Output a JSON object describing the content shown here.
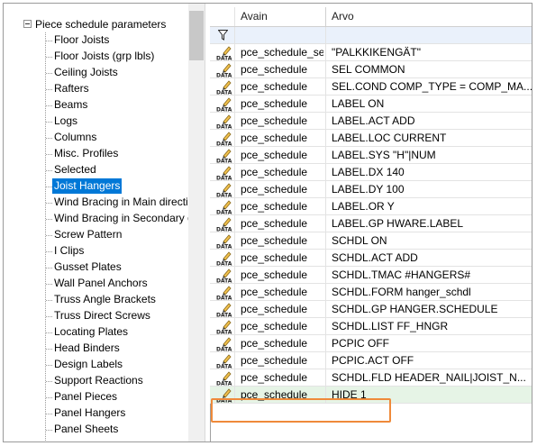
{
  "tree": {
    "root_label": "Piece schedule parameters",
    "items": [
      {
        "label": "Floor Joists"
      },
      {
        "label": "Floor Joists (grp lbls)"
      },
      {
        "label": "Ceiling Joists"
      },
      {
        "label": "Rafters"
      },
      {
        "label": "Beams"
      },
      {
        "label": "Logs"
      },
      {
        "label": "Columns"
      },
      {
        "label": "Misc. Profiles"
      },
      {
        "label": "Selected"
      },
      {
        "label": "Joist Hangers",
        "selected": true
      },
      {
        "label": "Wind Bracing in Main directi"
      },
      {
        "label": "Wind Bracing in Secondary d"
      },
      {
        "label": "Screw Pattern"
      },
      {
        "label": "I Clips"
      },
      {
        "label": "Gusset Plates"
      },
      {
        "label": "Wall Panel Anchors"
      },
      {
        "label": "Truss Angle Brackets"
      },
      {
        "label": "Truss Direct Screws"
      },
      {
        "label": "Locating Plates"
      },
      {
        "label": "Head Binders"
      },
      {
        "label": "Design Labels"
      },
      {
        "label": "Support Reactions"
      },
      {
        "label": "Panel Pieces"
      },
      {
        "label": "Panel Hangers"
      },
      {
        "label": "Panel Sheets"
      }
    ]
  },
  "grid": {
    "columns": [
      "Avain",
      "Arvo"
    ],
    "filter_icon": "funnel-icon",
    "row_icon": "data-pencil-icon",
    "rows": [
      {
        "key": "pce_schedule_set",
        "value": "\"PALKKIKENGÄT\""
      },
      {
        "key": "pce_schedule",
        "value": "SEL COMMON"
      },
      {
        "key": "pce_schedule",
        "value": "SEL.COND COMP_TYPE = COMP_MA..."
      },
      {
        "key": "pce_schedule",
        "value": "LABEL ON"
      },
      {
        "key": "pce_schedule",
        "value": "LABEL.ACT ADD"
      },
      {
        "key": "pce_schedule",
        "value": "LABEL.LOC CURRENT"
      },
      {
        "key": "pce_schedule",
        "value": "LABEL.SYS \"H\"|NUM"
      },
      {
        "key": "pce_schedule",
        "value": "LABEL.DX 140"
      },
      {
        "key": "pce_schedule",
        "value": "LABEL.DY 100"
      },
      {
        "key": "pce_schedule",
        "value": "LABEL.OR Y"
      },
      {
        "key": "pce_schedule",
        "value": "LABEL.GP HWARE.LABEL"
      },
      {
        "key": "pce_schedule",
        "value": "SCHDL ON"
      },
      {
        "key": "pce_schedule",
        "value": "SCHDL.ACT ADD"
      },
      {
        "key": "pce_schedule",
        "value": "SCHDL.TMAC #HANGERS#"
      },
      {
        "key": "pce_schedule",
        "value": "SCHDL.FORM hanger_schdl"
      },
      {
        "key": "pce_schedule",
        "value": "SCHDL.GP HANGER.SCHEDULE"
      },
      {
        "key": "pce_schedule",
        "value": "SCHDL.LIST FF_HNGR"
      },
      {
        "key": "pce_schedule",
        "value": "PCPIC OFF"
      },
      {
        "key": "pce_schedule",
        "value": "PCPIC.ACT OFF"
      },
      {
        "key": "pce_schedule",
        "value": "SCHDL.FLD HEADER_NAIL|JOIST_N..."
      },
      {
        "key": "pce_schedule",
        "value": "HIDE 1",
        "highlighted": true
      }
    ]
  },
  "colors": {
    "selection": "#0078d7",
    "highlight_row": "#e6f4e6",
    "annotation_box": "#ef8a3a",
    "filter_row": "#eaf1fb"
  }
}
